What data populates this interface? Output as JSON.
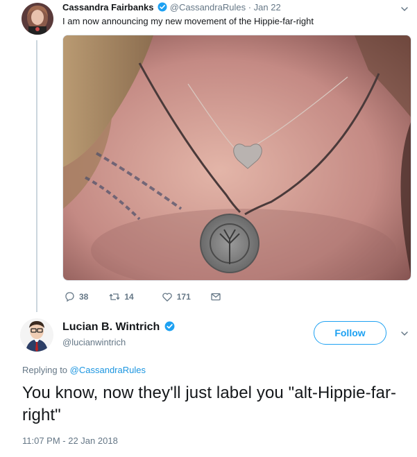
{
  "parent_tweet": {
    "author_name": "Cassandra Fairbanks",
    "handle": "@CassandraRules",
    "separator": "·",
    "date": "Jan 22",
    "text": "I am now announcing my new movement of the Hippie-far-right",
    "actions": {
      "replies": "38",
      "retweets": "14",
      "likes": "171"
    },
    "icons": [
      "reply-icon",
      "retweet-icon",
      "like-icon",
      "message-icon",
      "chevron-down-icon",
      "verified-badge-icon"
    ]
  },
  "main_tweet": {
    "author_name": "Lucian B. Wintrich",
    "handle": "@lucianwintrich",
    "follow_label": "Follow",
    "replying_prefix": "Replying to",
    "replying_handle": "@CassandraRules",
    "text": "You know, now they'll just label you \"alt-Hippie-far-right\"",
    "timestamp": "11:07 PM - 22 Jan 2018"
  },
  "colors": {
    "brand_blue": "#1da1f2",
    "link_blue": "#1b95e0",
    "muted_gray": "#657786",
    "thread_line": "#ccd6dd",
    "text": "#14171a"
  }
}
